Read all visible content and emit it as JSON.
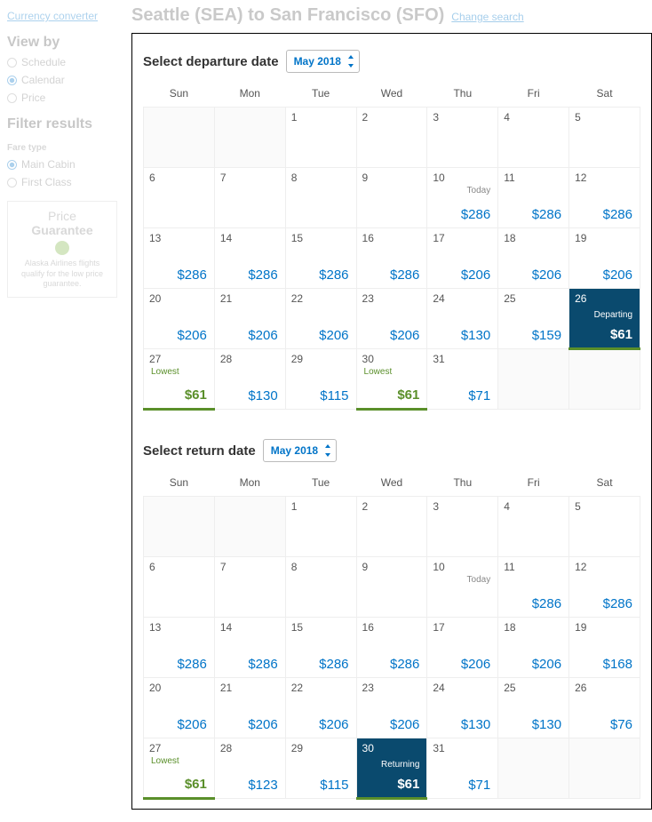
{
  "sidebar": {
    "currency_link": "Currency converter",
    "view_by": "View by",
    "v1": "Schedule",
    "v2": "Calendar",
    "v3": "Price",
    "filter": "Filter results",
    "fare_type": "Fare type",
    "f1": "Main Cabin",
    "f2": "First Class",
    "pg1": "Price",
    "pg2": "Guarantee",
    "pgd": "Alaska Airlines flights qualify for the low price guarantee."
  },
  "header": {
    "title": "Seattle (SEA) to San Francisco (SFO)",
    "change": "Change search"
  },
  "dep": {
    "label": "Select departure date",
    "month": "May 2018"
  },
  "ret": {
    "label": "Select return date",
    "month": "May 2018"
  },
  "dow": [
    "Sun",
    "Mon",
    "Tue",
    "Wed",
    "Thu",
    "Fri",
    "Sat"
  ],
  "chart_data": [
    {
      "type": "table",
      "title": "Departure prices — May 2018",
      "columns": [
        "Sun",
        "Mon",
        "Tue",
        "Wed",
        "Thu",
        "Fri",
        "Sat"
      ],
      "rows": [
        [
          null,
          null,
          {
            "d": 1
          },
          {
            "d": 2
          },
          {
            "d": 3
          },
          {
            "d": 4
          },
          {
            "d": 5
          }
        ],
        [
          {
            "d": 6
          },
          {
            "d": 7
          },
          {
            "d": 8
          },
          {
            "d": 9
          },
          {
            "d": 10,
            "today": true,
            "p": 286
          },
          {
            "d": 11,
            "p": 286
          },
          {
            "d": 12,
            "p": 286
          }
        ],
        [
          {
            "d": 13,
            "p": 286
          },
          {
            "d": 14,
            "p": 286
          },
          {
            "d": 15,
            "p": 286
          },
          {
            "d": 16,
            "p": 286
          },
          {
            "d": 17,
            "p": 206
          },
          {
            "d": 18,
            "p": 206
          },
          {
            "d": 19,
            "p": 206
          }
        ],
        [
          {
            "d": 20,
            "p": 206
          },
          {
            "d": 21,
            "p": 206
          },
          {
            "d": 22,
            "p": 206
          },
          {
            "d": 23,
            "p": 206
          },
          {
            "d": 24,
            "p": 130
          },
          {
            "d": 25,
            "p": 159
          },
          {
            "d": 26,
            "p": 61,
            "sel": "Departing"
          }
        ],
        [
          {
            "d": 27,
            "p": 61,
            "low": true
          },
          {
            "d": 28,
            "p": 130
          },
          {
            "d": 29,
            "p": 115
          },
          {
            "d": 30,
            "p": 61,
            "low": true
          },
          {
            "d": 31,
            "p": 71
          },
          null,
          null
        ]
      ]
    },
    {
      "type": "table",
      "title": "Return prices — May 2018",
      "columns": [
        "Sun",
        "Mon",
        "Tue",
        "Wed",
        "Thu",
        "Fri",
        "Sat"
      ],
      "rows": [
        [
          null,
          null,
          {
            "d": 1
          },
          {
            "d": 2
          },
          {
            "d": 3
          },
          {
            "d": 4
          },
          {
            "d": 5
          }
        ],
        [
          {
            "d": 6
          },
          {
            "d": 7
          },
          {
            "d": 8
          },
          {
            "d": 9
          },
          {
            "d": 10,
            "today": true
          },
          {
            "d": 11,
            "p": 286
          },
          {
            "d": 12,
            "p": 286
          }
        ],
        [
          {
            "d": 13,
            "p": 286
          },
          {
            "d": 14,
            "p": 286
          },
          {
            "d": 15,
            "p": 286
          },
          {
            "d": 16,
            "p": 286
          },
          {
            "d": 17,
            "p": 206
          },
          {
            "d": 18,
            "p": 206
          },
          {
            "d": 19,
            "p": 168
          }
        ],
        [
          {
            "d": 20,
            "p": 206
          },
          {
            "d": 21,
            "p": 206
          },
          {
            "d": 22,
            "p": 206
          },
          {
            "d": 23,
            "p": 206
          },
          {
            "d": 24,
            "p": 130
          },
          {
            "d": 25,
            "p": 130
          },
          {
            "d": 26,
            "p": 76
          }
        ],
        [
          {
            "d": 27,
            "p": 61,
            "low": true
          },
          {
            "d": 28,
            "p": 123
          },
          {
            "d": 29,
            "p": 115
          },
          {
            "d": 30,
            "p": 61,
            "sel": "Returning"
          },
          {
            "d": 31,
            "p": 71
          },
          null,
          null
        ]
      ]
    }
  ],
  "labels": {
    "today": "Today",
    "lowest": "Lowest"
  }
}
